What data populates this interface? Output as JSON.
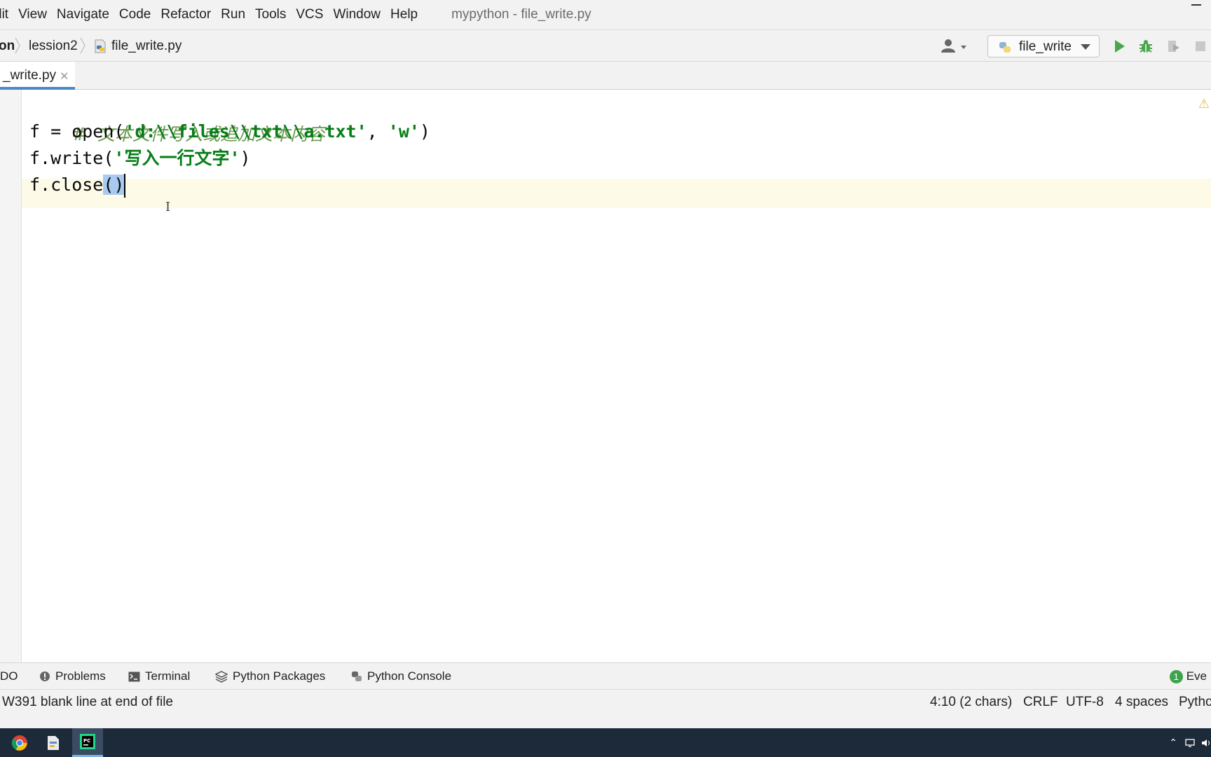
{
  "menu": {
    "items": [
      "Edit",
      "View",
      "Navigate",
      "Code",
      "Refactor",
      "Run",
      "Tools",
      "VCS",
      "Window",
      "Help"
    ],
    "display_items": [
      "dit",
      "View",
      "Navigate",
      "Code",
      "Refactor",
      "Run",
      "Tools",
      "VCS",
      "Window",
      "Help"
    ],
    "window_title": "mypython - file_write.py"
  },
  "breadcrumb": {
    "items": [
      "on",
      "lession2",
      "file_write.py"
    ]
  },
  "toolbar": {
    "run_config": "file_write"
  },
  "tabs": [
    {
      "label": "_write.py",
      "active": true
    }
  ],
  "editor": {
    "line1_comment": "#  文本文件写入或追加文本内容",
    "line2": {
      "prefix": "f = open(",
      "arg1": "'d:\\\\files\\\\txt\\\\a.txt'",
      "mid": ", ",
      "arg2": "'w'",
      "suffix": ")"
    },
    "line3": {
      "prefix": "f.write(",
      "arg": "'写入一行文字'",
      "suffix": ")"
    },
    "line4": {
      "text": "f.close",
      "parens": "()"
    }
  },
  "tool_windows": {
    "items": [
      "DO",
      "Problems",
      "Terminal",
      "Python Packages",
      "Python Console"
    ],
    "events_count": "1",
    "events_label": "Eve"
  },
  "status": {
    "message": "W391 blank line at end of file",
    "caret_position": "4:10 (2 chars)",
    "line_separator": "CRLF",
    "encoding": "UTF-8",
    "indent": "4 spaces",
    "interpreter": "Pytho"
  },
  "colors": {
    "comment": "#6a9a4e",
    "string": "#067d17",
    "paren_highlight": "#a8caf0",
    "tab_underline": "#4a88c7",
    "taskbar": "#1d2a3a"
  }
}
